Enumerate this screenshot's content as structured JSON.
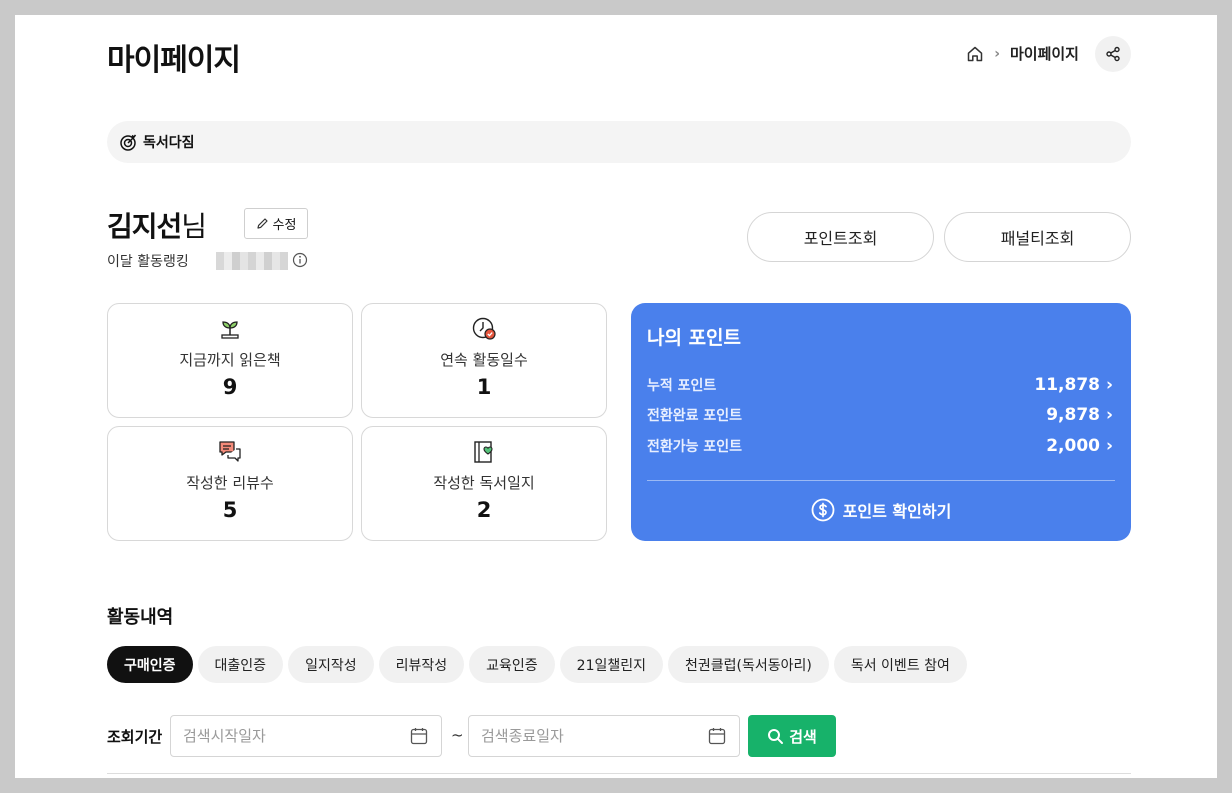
{
  "header": {
    "title": "마이페이지",
    "breadcrumb": {
      "home_icon": "home-icon",
      "current": "마이페이지"
    },
    "share_icon": "share-icon"
  },
  "pledge": {
    "label": "독서다짐",
    "icon": "target-icon"
  },
  "user": {
    "name": "김지선",
    "suffix": "님",
    "edit_label": "수정",
    "rank_label": "이달 활동랭킹"
  },
  "actions": {
    "point_lookup": "포인트조회",
    "penalty_lookup": "패널티조회"
  },
  "stats": [
    {
      "label": "지금까지 읽은책",
      "value": "9",
      "icon": "sprout-icon"
    },
    {
      "label": "연속 활동일수",
      "value": "1",
      "icon": "clock-check-icon"
    },
    {
      "label": "작성한 리뷰수",
      "value": "5",
      "icon": "chat-bubbles-icon"
    },
    {
      "label": "작성한 독서일지",
      "value": "2",
      "icon": "journal-heart-icon"
    }
  ],
  "points": {
    "title": "나의 포인트",
    "rows": [
      {
        "label": "누적 포인트",
        "value": "11,878"
      },
      {
        "label": "전환완료 포인트",
        "value": "9,878"
      },
      {
        "label": "전환가능 포인트",
        "value": "2,000"
      }
    ],
    "check_label": "포인트 확인하기",
    "accent": "#4a80ec"
  },
  "activity": {
    "title": "활동내역",
    "tabs": [
      "구매인증",
      "대출인증",
      "일지작성",
      "리뷰작성",
      "교육인증",
      "21일챌린지",
      "천권클럽(독서동아리)",
      "독서 이벤트 참여"
    ],
    "active_tab": 0
  },
  "search": {
    "period_label": "조회기간",
    "start_placeholder": "검색시작일자",
    "end_placeholder": "검색종료일자",
    "separator": "~",
    "button_label": "검색",
    "button_color": "#17b26a"
  }
}
